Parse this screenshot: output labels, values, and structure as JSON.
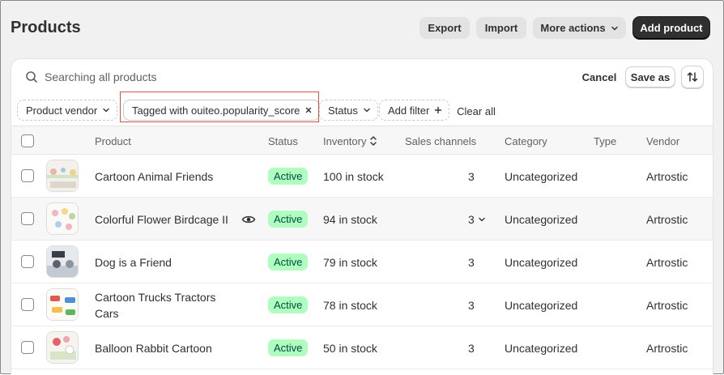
{
  "header": {
    "title": "Products",
    "export_label": "Export",
    "import_label": "Import",
    "more_actions_label": "More actions",
    "add_product_label": "Add product"
  },
  "search": {
    "placeholder": "Searching all products",
    "cancel_label": "Cancel",
    "save_as_label": "Save as"
  },
  "filters": {
    "vendor_label": "Product vendor",
    "tagged_label": "Tagged with ouiteo.popularity_score",
    "status_label": "Status",
    "add_filter_label": "Add filter",
    "clear_all_label": "Clear all"
  },
  "table": {
    "columns": {
      "product": "Product",
      "status": "Status",
      "inventory": "Inventory",
      "sales_channels": "Sales channels",
      "category": "Category",
      "type": "Type",
      "vendor": "Vendor"
    },
    "rows": [
      {
        "name": "Cartoon Animal Friends",
        "status": "Active",
        "inventory": "100 in stock",
        "channels": "3",
        "category": "Uncategorized",
        "type": "",
        "vendor": "Artrostic"
      },
      {
        "name": "Colorful Flower Birdcage II",
        "status": "Active",
        "inventory": "94 in stock",
        "channels": "3",
        "category": "Uncategorized",
        "type": "",
        "vendor": "Artrostic"
      },
      {
        "name": "Dog is a Friend",
        "status": "Active",
        "inventory": "79 in stock",
        "channels": "3",
        "category": "Uncategorized",
        "type": "",
        "vendor": "Artrostic"
      },
      {
        "name": "Cartoon Trucks Tractors Cars",
        "status": "Active",
        "inventory": "78 in stock",
        "channels": "3",
        "category": "Uncategorized",
        "type": "",
        "vendor": "Artrostic"
      },
      {
        "name": "Balloon Rabbit Cartoon",
        "status": "Active",
        "inventory": "50 in stock",
        "channels": "3",
        "category": "Uncategorized",
        "type": "",
        "vendor": "Artrostic"
      }
    ]
  },
  "colors": {
    "accent": "#303030",
    "active_badge_bg": "#affebf",
    "active_badge_text": "#014b40",
    "highlight": "#e05048"
  }
}
